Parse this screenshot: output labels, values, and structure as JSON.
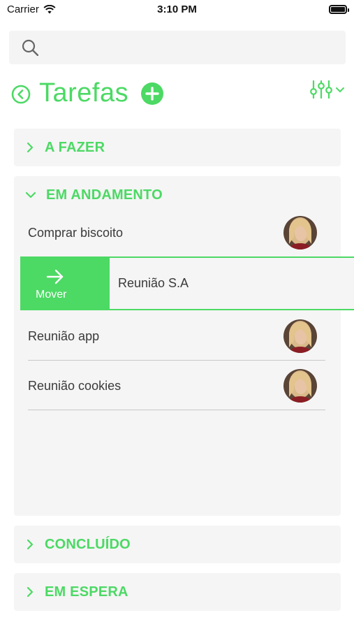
{
  "status_bar": {
    "carrier": "Carrier",
    "time": "3:10 PM"
  },
  "search": {
    "placeholder": ""
  },
  "header": {
    "title": "Tarefas"
  },
  "sections": {
    "todo": {
      "label": "A FAZER",
      "expanded": false
    },
    "in_progress": {
      "label": "EM ANDAMENTO",
      "expanded": true,
      "tasks": [
        {
          "title": "Comprar biscoito"
        },
        {
          "title": "Reunião S.A",
          "swiped": true,
          "action_label": "Mover"
        },
        {
          "title": "Reunião app"
        },
        {
          "title": "Reunião cookies"
        }
      ]
    },
    "done": {
      "label": "CONCLUÍDO",
      "expanded": false
    },
    "on_hold": {
      "label": "EM ESPERA",
      "expanded": false
    }
  },
  "colors": {
    "accent": "#4cd964",
    "section_bg": "#f5f5f5",
    "search_bg": "#f4f4f4"
  }
}
